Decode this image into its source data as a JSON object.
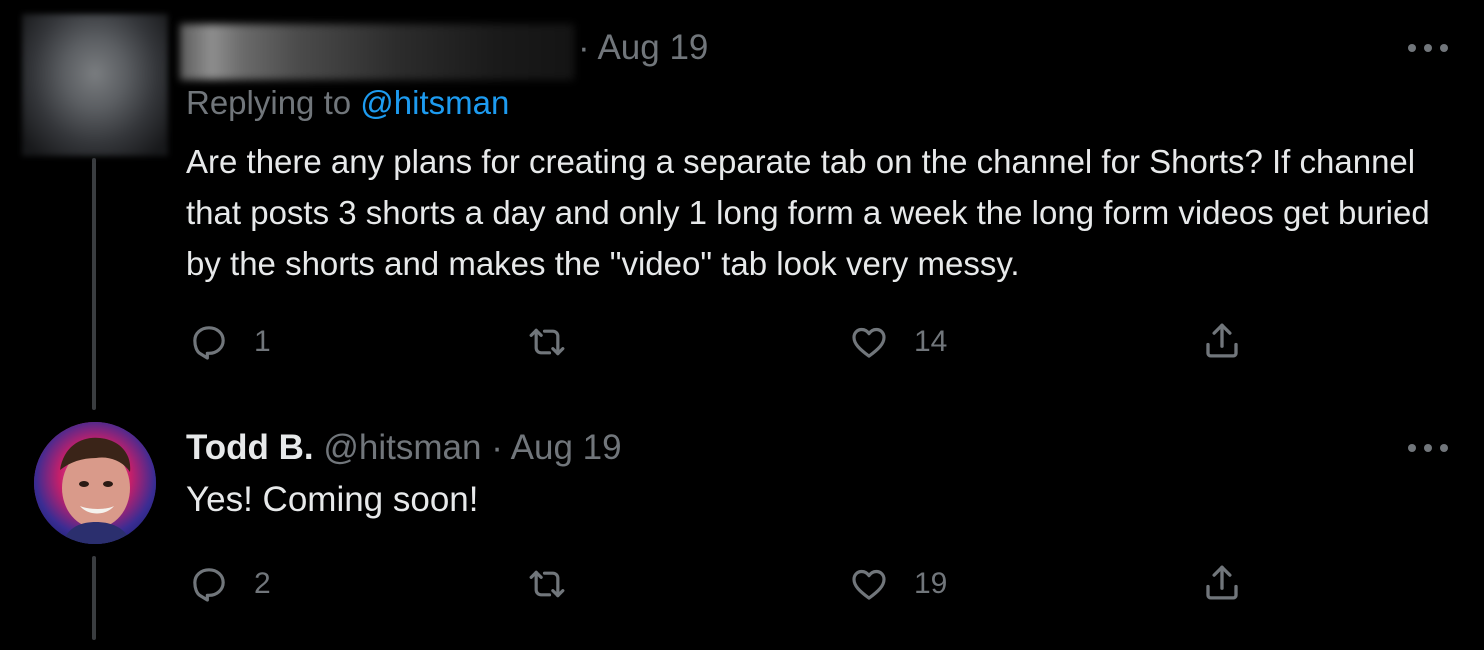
{
  "tweet1": {
    "date_separator": "·",
    "date": "Aug 19",
    "replying_prefix": "Replying to ",
    "replying_handle": "@hitsman",
    "text": "Are there any plans for creating a separate tab on the channel for Shorts? If channel that posts 3 shorts a day and only 1 long form a week the long form videos get buried by the shorts and makes the \"video\" tab look very messy.",
    "actions": {
      "reply_icon": "reply-icon",
      "reply_count": "1",
      "retweet_icon": "retweet-icon",
      "like_icon": "heart-icon",
      "like_count": "14",
      "share_icon": "share-icon"
    }
  },
  "tweet2": {
    "name": "Todd B.",
    "handle": "@hitsman",
    "date_separator": "·",
    "date": "Aug 19",
    "text": "Yes! Coming soon!",
    "actions": {
      "reply_icon": "reply-icon",
      "reply_count": "2",
      "retweet_icon": "retweet-icon",
      "like_icon": "heart-icon",
      "like_count": "19",
      "share_icon": "share-icon"
    }
  },
  "colors": {
    "background": "#000000",
    "primary_text": "#e7e9ea",
    "secondary_text": "#71767b",
    "accent": "#1d9bf0",
    "thread_line": "#3a3d40"
  }
}
